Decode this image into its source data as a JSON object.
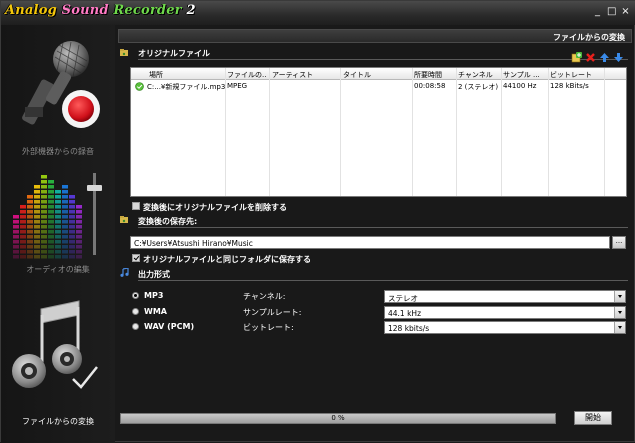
{
  "app": {
    "title_words": [
      "Analog",
      "Sound",
      "Recorder",
      "2"
    ],
    "window_controls": [
      "_",
      "□",
      "×"
    ]
  },
  "sidebar": {
    "items": [
      {
        "label": "外部機器からの録音",
        "icon": "microphone-record-icon",
        "active": false
      },
      {
        "label": "オーディオの編集",
        "icon": "equalizer-icon",
        "active": false
      },
      {
        "label": "ファイルからの変換",
        "icon": "music-note-convert-icon",
        "active": true
      }
    ]
  },
  "header": {
    "page_title": "ファイルからの変換"
  },
  "original_files": {
    "section_title": "オリジナルファイル",
    "toolbar_icons": [
      "add-file-icon",
      "delete-icon",
      "move-up-icon",
      "move-down-icon"
    ],
    "columns": [
      "場所",
      "ファイルの...",
      "アーティスト",
      "タイトル",
      "所要時間",
      "チャンネル",
      "サンプル ...",
      "ビットレート"
    ],
    "rows": [
      [
        "C:...¥新規ファイル.mp3",
        "MPEG",
        "",
        "",
        "00:08:58",
        "2 (ステレオ)",
        "44100 Hz",
        "128 kBits/s"
      ]
    ],
    "delete_after_label": "変換後にオリジナルファイルを削除する",
    "delete_after_checked": false
  },
  "destination": {
    "section_title": "変換後の保存先:",
    "path": "C:¥Users¥Atsushi Hirano¥Music",
    "browse_label": "...",
    "same_folder_label": "オリジナルファイルと同じフォルダに保存する",
    "same_folder_checked": true
  },
  "output": {
    "section_title": "出力形式",
    "formats": [
      {
        "label": "MP3",
        "selected": true
      },
      {
        "label": "WMA",
        "selected": false
      },
      {
        "label": "WAV (PCM)",
        "selected": false
      }
    ],
    "settings": [
      {
        "label": "チャンネル:",
        "value": "ステレオ"
      },
      {
        "label": "サンプルレート:",
        "value": "44.1 kHz"
      },
      {
        "label": "ビットレート:",
        "value": "128 kbits/s"
      }
    ]
  },
  "footer": {
    "progress_text": "0 %",
    "progress_value": 0,
    "start_label": "開始"
  },
  "colors": {
    "background": "#191919",
    "record_red": "#e8141c",
    "logo_yellow": "#f4c70b",
    "logo_pink": "#ff7ac4",
    "logo_green": "#6fd84c"
  }
}
